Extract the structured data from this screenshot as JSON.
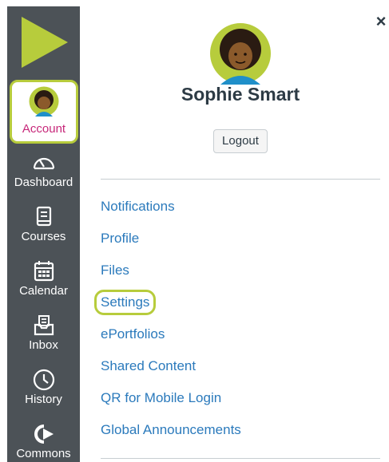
{
  "global_nav": {
    "brand_color": "#b7cc3c",
    "background": "#4c5257",
    "account": {
      "label": "Account",
      "icon": "avatar"
    },
    "items": [
      {
        "label": "Dashboard",
        "icon": "dashboard-gauge-icon"
      },
      {
        "label": "Courses",
        "icon": "courses-book-icon"
      },
      {
        "label": "Calendar",
        "icon": "calendar-icon"
      },
      {
        "label": "Inbox",
        "icon": "inbox-icon"
      },
      {
        "label": "History",
        "icon": "history-clock-icon"
      },
      {
        "label": "Commons",
        "icon": "commons-arrow-icon"
      }
    ]
  },
  "tray": {
    "close_glyph": "×",
    "user_name": "Sophie Smart",
    "logout_label": "Logout",
    "links": [
      {
        "label": "Notifications"
      },
      {
        "label": "Profile"
      },
      {
        "label": "Files"
      },
      {
        "label": "Settings",
        "highlighted": true
      },
      {
        "label": "ePortfolios"
      },
      {
        "label": "Shared Content"
      },
      {
        "label": "QR for Mobile Login"
      },
      {
        "label": "Global Announcements"
      }
    ]
  }
}
